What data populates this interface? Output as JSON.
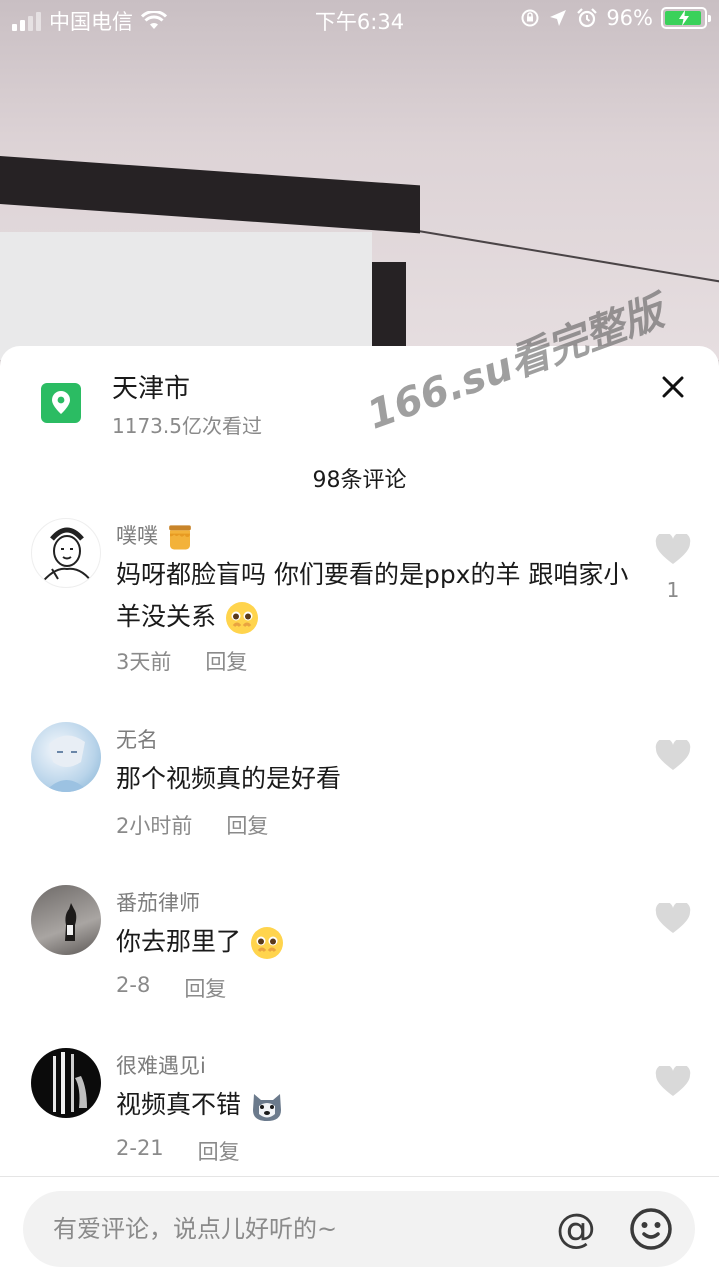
{
  "status_bar": {
    "carrier": "中国电信",
    "time": "下午6:34",
    "battery_percent": "96%",
    "battery_level": 0.96
  },
  "location": {
    "name": "天津市",
    "views": "1173.5亿次看过"
  },
  "watermark": "166.su看完整版",
  "comments_header": "98条评论",
  "comments": [
    {
      "username": "噗噗",
      "text": "妈呀都脸盲吗 你们要看的是ppx的羊 跟咱家小羊没关系",
      "time": "3天前",
      "reply": "回复",
      "likes": "1"
    },
    {
      "username": "无名",
      "text": "那个视频真的是好看",
      "time": "2小时前",
      "reply": "回复",
      "likes": ""
    },
    {
      "username": "番茄律师",
      "text": "你去那里了",
      "time": "2-8",
      "reply": "回复",
      "likes": ""
    },
    {
      "username": "很难遇见i",
      "text": "视频真不错",
      "time": "2-21",
      "reply": "回复",
      "likes": ""
    }
  ],
  "input": {
    "placeholder": "有爱评论，说点儿好听的~",
    "at_label": "@"
  }
}
